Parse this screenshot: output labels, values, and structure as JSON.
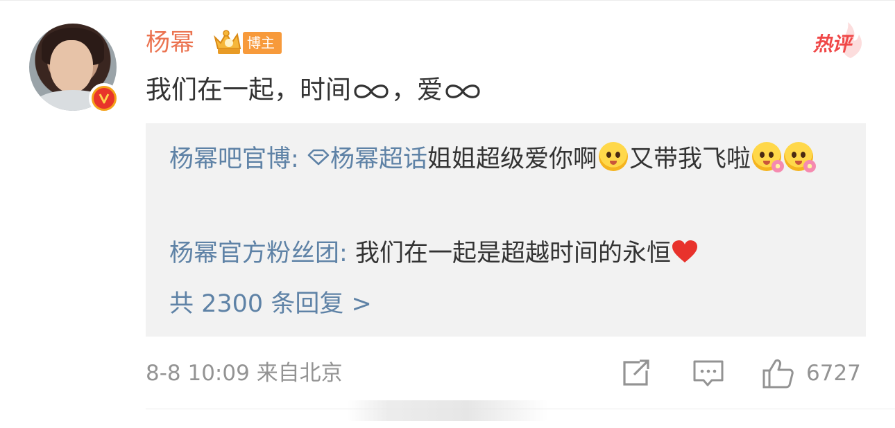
{
  "comment": {
    "username": "杨幂",
    "role_badge": "博主",
    "hot_tag": "热评",
    "text_prefix": "我们在一起，时间",
    "text_mid": "，爱",
    "time": "8-8 10:09",
    "location": "来自北京",
    "likes": "6727"
  },
  "replies": [
    {
      "author": "杨幂吧官博",
      "separator": ":",
      "topic": "杨幂超话",
      "text_a": "姐姐超级爱你啊",
      "text_b": "又带我飞啦"
    },
    {
      "author": "杨幂官方粉丝团",
      "separator": ":",
      "text": "我们在一起是超越时间的永恒"
    }
  ],
  "reply_count_label": "共 2300 条回复 >",
  "icons": [
    "verified-v-icon",
    "crown-level-icon",
    "infinity-icon",
    "topic-diamond-icon",
    "emoji-icon",
    "heart-icon",
    "share-icon",
    "comment-icon",
    "like-icon"
  ],
  "colors": {
    "username": "#eb7350",
    "link": "#5e82a6",
    "badge": "#f79a3b",
    "hot": "#f04848",
    "meta": "#939393",
    "reply_bg": "#f2f2f2"
  }
}
